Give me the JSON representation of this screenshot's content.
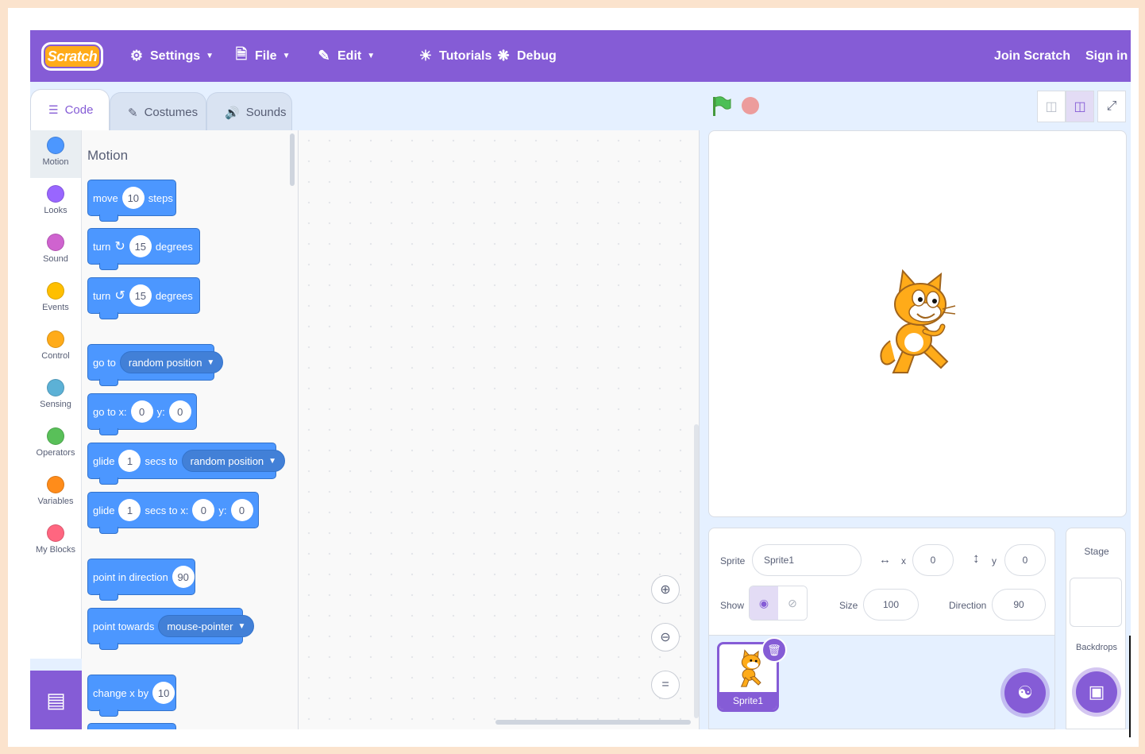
{
  "menubar": {
    "logo_text": "Scratch",
    "settings_label": "Settings",
    "file_label": "File",
    "edit_label": "Edit",
    "tutorials_label": "Tutorials",
    "debug_label": "Debug",
    "join_label": "Join Scratch",
    "signin_label": "Sign in"
  },
  "tabs": [
    {
      "label": "Code",
      "icon": "code-icon",
      "active": true
    },
    {
      "label": "Costumes",
      "icon": "brush-icon",
      "active": false
    },
    {
      "label": "Sounds",
      "icon": "speaker-icon",
      "active": false
    }
  ],
  "categories": [
    {
      "label": "Motion",
      "color": "#4c97ff",
      "active": true
    },
    {
      "label": "Looks",
      "color": "#9966ff"
    },
    {
      "label": "Sound",
      "color": "#cf63cf"
    },
    {
      "label": "Events",
      "color": "#ffbf00"
    },
    {
      "label": "Control",
      "color": "#ffab19"
    },
    {
      "label": "Sensing",
      "color": "#5cb1d6"
    },
    {
      "label": "Operators",
      "color": "#59c059"
    },
    {
      "label": "Variables",
      "color": "#ff8c1a"
    },
    {
      "label": "My Blocks",
      "color": "#ff6680"
    }
  ],
  "palette": {
    "section_title": "Motion",
    "blocks": {
      "move": {
        "a": "move",
        "v": "10",
        "b": "steps"
      },
      "turn_right": {
        "a": "turn",
        "v": "15",
        "b": "degrees"
      },
      "turn_left": {
        "a": "turn",
        "v": "15",
        "b": "degrees"
      },
      "goto": {
        "a": "go to",
        "drop": "random position"
      },
      "goto_xy": {
        "a": "go to x:",
        "x": "0",
        "ylab": "y:",
        "y": "0"
      },
      "glide_to": {
        "a": "glide",
        "v": "1",
        "b": "secs to",
        "drop": "random position"
      },
      "glide_xy": {
        "a": "glide",
        "v": "1",
        "b": "secs to x:",
        "x": "0",
        "ylab": "y:",
        "y": "0"
      },
      "point_dir": {
        "a": "point in direction",
        "v": "90"
      },
      "point_towards": {
        "a": "point towards",
        "drop": "mouse-pointer"
      },
      "change_x": {
        "a": "change x by",
        "v": "10"
      }
    }
  },
  "sprite_info": {
    "sprite_label": "Sprite",
    "sprite_name": "Sprite1",
    "x_label": "x",
    "x_value": "0",
    "y_label": "y",
    "y_value": "0",
    "show_label": "Show",
    "size_label": "Size",
    "size_value": "100",
    "direction_label": "Direction",
    "direction_value": "90"
  },
  "sprites": [
    {
      "name": "Sprite1",
      "selected": true
    }
  ],
  "stage_pane": {
    "title": "Stage",
    "backdrops_label": "Backdrops"
  },
  "colors": {
    "menubar": "#855cd6",
    "motion": "#4c97ff",
    "flag": "#4cbf56",
    "stop": "#ec9c9c",
    "cat_orange": "#ffab19"
  }
}
